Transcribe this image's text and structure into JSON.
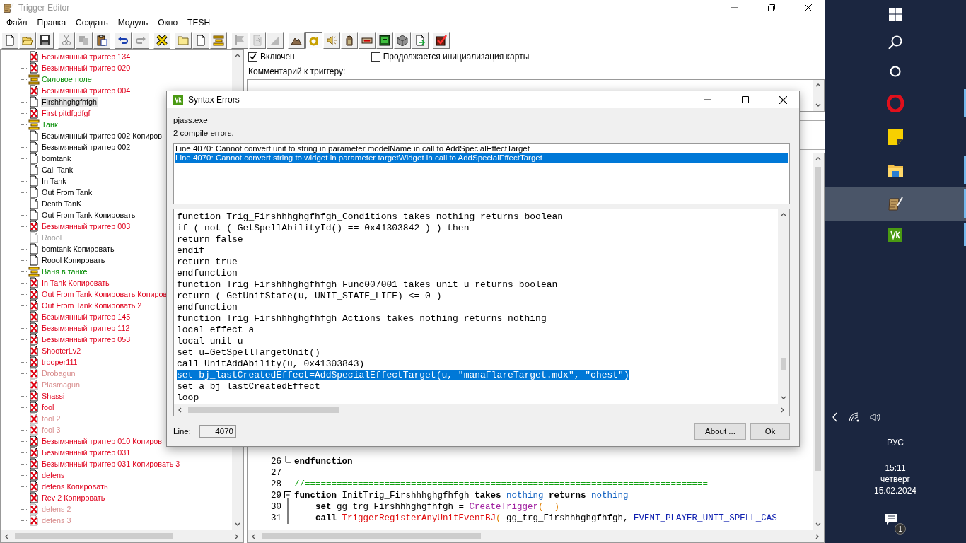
{
  "window": {
    "title": "Trigger Editor"
  },
  "menu": [
    "Файл",
    "Правка",
    "Создать",
    "Модуль",
    "Окно",
    "TESH"
  ],
  "toolbar": [
    {
      "kind": "new",
      "disabled": false,
      "pressed": false
    },
    {
      "kind": "open",
      "disabled": false,
      "pressed": false
    },
    {
      "kind": "save",
      "disabled": false,
      "pressed": false
    },
    {
      "kind": "cut",
      "disabled": true,
      "pressed": false
    },
    {
      "kind": "copy",
      "disabled": true,
      "pressed": false
    },
    {
      "kind": "paste",
      "disabled": false,
      "pressed": false
    },
    {
      "kind": "undo",
      "disabled": false,
      "pressed": false
    },
    {
      "kind": "redo",
      "disabled": true,
      "pressed": false
    },
    {
      "kind": "test",
      "disabled": false,
      "pressed": false
    },
    {
      "kind": "category",
      "disabled": false,
      "pressed": false
    },
    {
      "kind": "trigger",
      "disabled": false,
      "pressed": false
    },
    {
      "kind": "comment",
      "disabled": false,
      "pressed": false
    },
    {
      "kind": "flag",
      "disabled": true,
      "pressed": false
    },
    {
      "kind": "swap",
      "disabled": true,
      "pressed": false
    },
    {
      "kind": "wedge",
      "disabled": true,
      "pressed": false
    },
    {
      "kind": "terrain",
      "disabled": false,
      "pressed": false
    },
    {
      "kind": "ring",
      "disabled": false,
      "pressed": true
    },
    {
      "kind": "sound",
      "disabled": false,
      "pressed": false
    },
    {
      "kind": "unit",
      "disabled": false,
      "pressed": false
    },
    {
      "kind": "board",
      "disabled": false,
      "pressed": false
    },
    {
      "kind": "green",
      "disabled": false,
      "pressed": false
    },
    {
      "kind": "cube",
      "disabled": false,
      "pressed": false
    },
    {
      "kind": "export",
      "disabled": false,
      "pressed": false
    },
    {
      "kind": "check",
      "disabled": false,
      "pressed": false
    }
  ],
  "trigger_tree": [
    {
      "label": "Безымянный триггер 134",
      "kind": "trigger",
      "enabled": false,
      "initially_on": true,
      "selected": false
    },
    {
      "label": "Безымянный триггер 020",
      "kind": "trigger",
      "enabled": false,
      "initially_on": true,
      "selected": false
    },
    {
      "label": "Силовое поле",
      "kind": "comment",
      "selected": false
    },
    {
      "label": "Безымянный триггер 004",
      "kind": "trigger",
      "enabled": false,
      "initially_on": true,
      "selected": false
    },
    {
      "label": "Firshhhghgfhfgh",
      "kind": "trigger",
      "enabled": true,
      "initially_on": true,
      "selected": true
    },
    {
      "label": "First pitdfgdfgf",
      "kind": "trigger",
      "enabled": false,
      "initially_on": true,
      "selected": false
    },
    {
      "label": "Танк",
      "kind": "comment",
      "selected": false
    },
    {
      "label": "Безымянный триггер 002 Копиров",
      "kind": "trigger",
      "enabled": true,
      "initially_on": true,
      "selected": false
    },
    {
      "label": "Безымянный триггер 002",
      "kind": "trigger",
      "enabled": true,
      "initially_on": true,
      "selected": false
    },
    {
      "label": "bomtank",
      "kind": "trigger",
      "enabled": true,
      "initially_on": true,
      "selected": false
    },
    {
      "label": "Call Tank",
      "kind": "trigger",
      "enabled": true,
      "initially_on": true,
      "selected": false
    },
    {
      "label": "In Tank",
      "kind": "trigger",
      "enabled": true,
      "initially_on": true,
      "selected": false
    },
    {
      "label": "Out From Tank",
      "kind": "trigger",
      "enabled": true,
      "initially_on": true,
      "selected": false
    },
    {
      "label": "Death TanK",
      "kind": "trigger",
      "enabled": true,
      "initially_on": true,
      "selected": false
    },
    {
      "label": "Out From Tank Копировать",
      "kind": "trigger",
      "enabled": true,
      "initially_on": true,
      "selected": false
    },
    {
      "label": "Безымянный триггер 003",
      "kind": "trigger",
      "enabled": false,
      "initially_on": true,
      "selected": false
    },
    {
      "label": "Roool",
      "kind": "trigger",
      "enabled": true,
      "initially_on": false,
      "selected": false
    },
    {
      "label": "bomtank Копировать",
      "kind": "trigger",
      "enabled": true,
      "initially_on": true,
      "selected": false
    },
    {
      "label": "Roool Копировать",
      "kind": "trigger",
      "enabled": true,
      "initially_on": true,
      "selected": false
    },
    {
      "label": "Ваня в танке",
      "kind": "comment",
      "selected": false
    },
    {
      "label": "In Tank Копировать",
      "kind": "trigger",
      "enabled": false,
      "initially_on": true,
      "selected": false
    },
    {
      "label": "Out From Tank Копировать Копиров",
      "kind": "trigger",
      "enabled": false,
      "initially_on": true,
      "selected": false
    },
    {
      "label": "Out From Tank Копировать 2",
      "kind": "trigger",
      "enabled": false,
      "initially_on": true,
      "selected": false
    },
    {
      "label": "Безымянный триггер 145",
      "kind": "trigger",
      "enabled": false,
      "initially_on": true,
      "selected": false
    },
    {
      "label": "Безымянный триггер 112",
      "kind": "trigger",
      "enabled": false,
      "initially_on": true,
      "selected": false
    },
    {
      "label": "Безымянный триггер 053",
      "kind": "trigger",
      "enabled": false,
      "initially_on": true,
      "selected": false
    },
    {
      "label": "ShooterLv2",
      "kind": "trigger",
      "enabled": false,
      "initially_on": true,
      "selected": false
    },
    {
      "label": "trooper111",
      "kind": "trigger",
      "enabled": false,
      "initially_on": true,
      "selected": false
    },
    {
      "label": "Drobagun",
      "kind": "trigger",
      "enabled": false,
      "initially_on": false,
      "selected": false
    },
    {
      "label": "Plasmagun",
      "kind": "trigger",
      "enabled": false,
      "initially_on": false,
      "selected": false
    },
    {
      "label": "Shassi",
      "kind": "trigger",
      "enabled": false,
      "initially_on": true,
      "selected": false
    },
    {
      "label": "fool",
      "kind": "trigger",
      "enabled": false,
      "initially_on": true,
      "selected": false
    },
    {
      "label": "fool 2",
      "kind": "trigger",
      "enabled": false,
      "initially_on": false,
      "selected": false
    },
    {
      "label": "fool 3",
      "kind": "trigger",
      "enabled": false,
      "initially_on": false,
      "selected": false
    },
    {
      "label": "Безымянный триггер 010 Копиров",
      "kind": "trigger",
      "enabled": false,
      "initially_on": true,
      "selected": false
    },
    {
      "label": "Безымянный триггер 031",
      "kind": "trigger",
      "enabled": false,
      "initially_on": true,
      "selected": false
    },
    {
      "label": "Безымянный триггер 031 Копировать 3",
      "kind": "trigger",
      "enabled": false,
      "initially_on": true,
      "selected": false
    },
    {
      "label": "defens",
      "kind": "trigger",
      "enabled": false,
      "initially_on": true,
      "selected": false
    },
    {
      "label": "defens Копировать",
      "kind": "trigger",
      "enabled": false,
      "initially_on": true,
      "selected": false
    },
    {
      "label": "Rev 2 Копировать",
      "kind": "trigger",
      "enabled": false,
      "initially_on": true,
      "selected": false
    },
    {
      "label": "defens 2",
      "kind": "trigger",
      "enabled": false,
      "initially_on": false,
      "selected": false
    },
    {
      "label": "defens 3",
      "kind": "trigger",
      "enabled": false,
      "initially_on": false,
      "selected": false
    }
  ],
  "trigger_panel": {
    "enabled_checkbox": {
      "label": "Включен",
      "checked": true
    },
    "init_checkbox": {
      "label": "Продолжается инициализация карты",
      "checked": false
    },
    "comment_label": "Комментарий к триггеру:"
  },
  "editor_lines": [
    {
      "number": "26",
      "kind": "fold_end",
      "tokens": [
        {
          "text": "endfunction",
          "kind": "keyword"
        }
      ]
    },
    {
      "number": "27",
      "kind": "plain"
    },
    {
      "number": "28",
      "kind": "plain",
      "tokens": [
        {
          "text": "//============================================================================",
          "kind": "comment"
        }
      ]
    },
    {
      "number": "29",
      "kind": "fold_start",
      "tokens": [
        {
          "text": "function",
          "kind": "keyword"
        },
        {
          "text": " InitTrig_Firshhhghgfhfgh ",
          "kind": "plain"
        },
        {
          "text": "takes",
          "kind": "keyword"
        },
        {
          "text": " nothing ",
          "kind": "type"
        },
        {
          "text": "returns",
          "kind": "keyword"
        },
        {
          "text": " nothing",
          "kind": "type"
        }
      ]
    },
    {
      "number": "30",
      "kind": "fold_inside",
      "tokens": [
        {
          "text": "    set",
          "kind": "keyword"
        },
        {
          "text": " gg_trg_Firshhhghgfhfgh = ",
          "kind": "plain"
        },
        {
          "text": "CreateTrigger",
          "kind": "native"
        },
        {
          "text": "(  )",
          "kind": "paren"
        }
      ]
    },
    {
      "number": "31",
      "kind": "fold_inside",
      "tokens": [
        {
          "text": "    call ",
          "kind": "keyword"
        },
        {
          "text": "TriggerRegisterAnyUnitEventBJ",
          "kind": "bj"
        },
        {
          "text": "(",
          "kind": "paren"
        },
        {
          "text": " gg_trg_Firshhhghgfhfgh, ",
          "kind": "plain"
        },
        {
          "text": "EVENT_PLAYER_UNIT_SPELL_CAS",
          "kind": "constant"
        }
      ]
    }
  ],
  "syntax_errors_dialog": {
    "title": "Syntax Errors",
    "tool": "pjass.exe",
    "summary": "2 compile errors.",
    "errors": [
      {
        "text": "Line 4070:  Cannot convert unit to string in parameter modelName in call to AddSpecialEffectTarget",
        "selected": false
      },
      {
        "text": "Line 4070:  Cannot convert string to widget in parameter targetWidget in call to AddSpecialEffectTarget",
        "selected": true
      }
    ],
    "code_lines": [
      {
        "text": "function Trig_Firshhhghgfhfgh_Conditions takes nothing returns boolean",
        "selected": false
      },
      {
        "text": "if ( not ( GetSpellAbilityId() == 0x41303842 ) ) then",
        "selected": false
      },
      {
        "text": "return false",
        "selected": false
      },
      {
        "text": "endif",
        "selected": false
      },
      {
        "text": "return true",
        "selected": false
      },
      {
        "text": "endfunction",
        "selected": false
      },
      {
        "text": "function Trig_Firshhhghgfhfgh_Func007001 takes unit u returns boolean",
        "selected": false
      },
      {
        "text": "return ( GetUnitState(u, UNIT_STATE_LIFE) <= 0 )",
        "selected": false
      },
      {
        "text": "endfunction",
        "selected": false
      },
      {
        "text": "function Trig_Firshhhghgfhfgh_Actions takes nothing returns nothing",
        "selected": false
      },
      {
        "text": "local effect a",
        "selected": false
      },
      {
        "text": "local unit u",
        "selected": false
      },
      {
        "text": "set u=GetSpellTargetUnit()",
        "selected": false
      },
      {
        "text": "call UnitAddAbility(u, 0x41303843)",
        "selected": false
      },
      {
        "text": "set bj_lastCreatedEffect=AddSpecialEffectTarget(u, \"manaFlareTarget.mdx\", \"chest\")",
        "selected": true
      },
      {
        "text": "set a=bj_lastCreatedEffect",
        "selected": false
      },
      {
        "text": "loop",
        "selected": false
      }
    ],
    "line_label": "Line:",
    "line_value": "4070",
    "buttons": [
      "About ...",
      "Ok"
    ]
  },
  "taskbar": {
    "apps": [
      {
        "kind": "start",
        "running": false,
        "selected": false
      },
      {
        "kind": "search",
        "running": false,
        "selected": false
      },
      {
        "kind": "cortana",
        "running": false,
        "selected": false
      },
      {
        "kind": "browser",
        "running": true,
        "selected": false
      },
      {
        "kind": "notes",
        "running": false,
        "selected": false
      },
      {
        "kind": "folder",
        "running": true,
        "selected": false
      },
      {
        "kind": "editor",
        "running": true,
        "selected": true
      },
      {
        "kind": "jass",
        "running": true,
        "selected": false
      }
    ],
    "language": "РУС",
    "time": "15:11",
    "weekday": "четверг",
    "date": "15.02.2024",
    "notification_count": "1"
  }
}
